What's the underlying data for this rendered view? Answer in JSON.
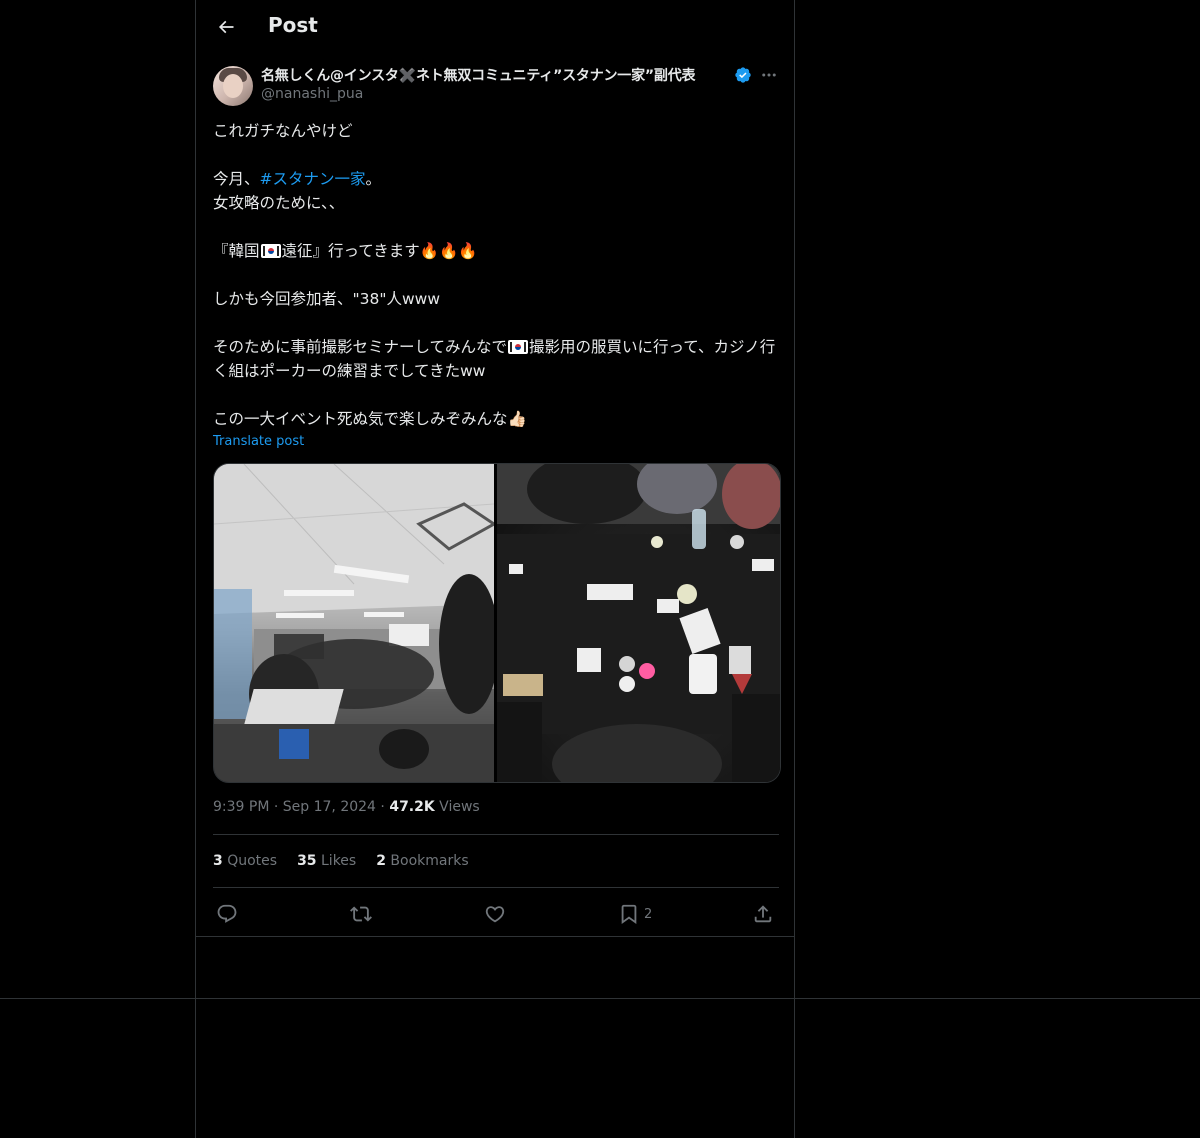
{
  "header": {
    "title": "Post"
  },
  "author": {
    "display_name": "名無しくん@インスタ✖️ネト無双コミュニティ”スタナン一家”副代表",
    "handle": "@nanashi_pua"
  },
  "tweet": {
    "line1": "これガチなんやけど",
    "line2_before": "今月、",
    "hashtag": "#スタナン一家",
    "line2_after": "。",
    "line3": "女攻略のために、、",
    "line4_before": "『韓国",
    "line4_after": "遠征』行ってきます🔥🔥🔥",
    "line5": "しかも今回参加者、\"38\"人www",
    "line6_before": "そのために事前撮影セミナーしてみんなで",
    "line6_after": "撮影用の服買いに行って、カジノ行く組はポーカーの練習までしてきたww",
    "line7": "この一大イベント死ぬ気で楽しみぞみんな👍🏻",
    "translate": "Translate post"
  },
  "meta": {
    "time": "9:39 PM",
    "sep": "·",
    "date": "Sep 17, 2024",
    "views_count": "47.2K",
    "views_label": "Views"
  },
  "stats": {
    "quotes_count": "3",
    "quotes_label": "Quotes",
    "likes_count": "35",
    "likes_label": "Likes",
    "bookmarks_count": "2",
    "bookmarks_label": "Bookmarks"
  },
  "actions": {
    "bookmark_count": "2"
  },
  "icons": [
    "back-arrow-icon",
    "verified-badge-icon",
    "more-icon",
    "reply-icon",
    "repost-icon",
    "like-icon",
    "bookmark-icon",
    "share-icon"
  ],
  "colors": {
    "background": "#000000",
    "text": "#e7e9ea",
    "secondary": "#71767b",
    "accent": "#1d9bf0",
    "border": "#2f3336"
  }
}
